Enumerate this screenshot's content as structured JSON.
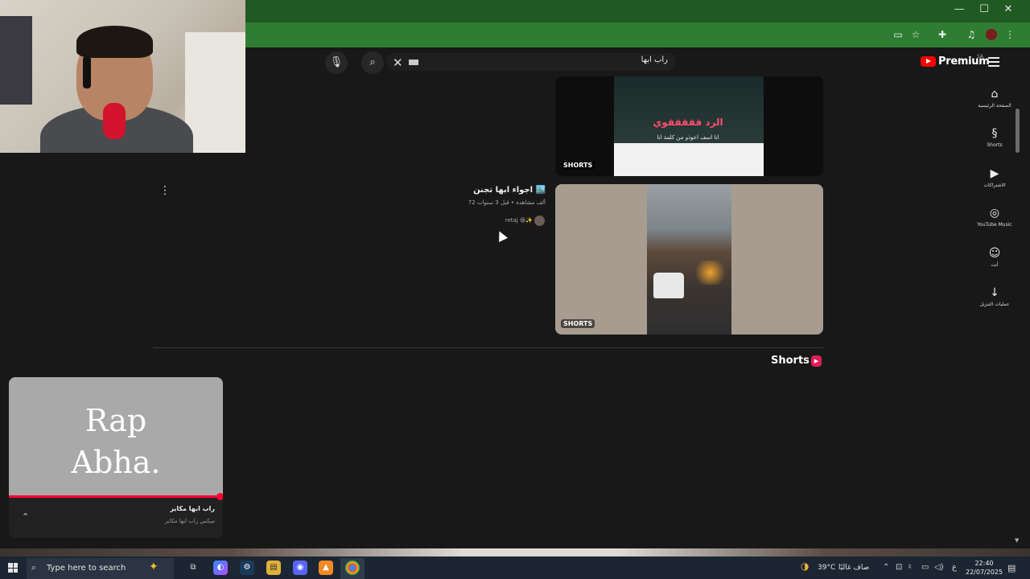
{
  "window": {
    "minimize": "—",
    "maximize": "☐",
    "close": "✕"
  },
  "toolbar_icons": [
    "cast-icon",
    "star-icon",
    "extensions-icon",
    "media-icon",
    "profile-icon",
    "menu-icon"
  ],
  "youtube": {
    "logo_text": "Premium",
    "region": "SA",
    "search_query": "راب ابها",
    "sidebar": [
      {
        "label": "الصفحة الرئيسية",
        "icon": "⌂"
      },
      {
        "label": "Shorts",
        "icon": "§"
      },
      {
        "label": "الاشتراكات",
        "icon": "▶"
      },
      {
        "label": "YouTube Music",
        "icon": "◎"
      },
      {
        "label": "أنت",
        "icon": "☺"
      },
      {
        "label": "عمليات التنزيل",
        "icon": "↓"
      }
    ],
    "card1": {
      "caption": "الرد قققققوي",
      "sub": "انا اسف اعوذو من كلمة انا",
      "badge": "SHORTS"
    },
    "card2": {
      "title": "اجواء ابها تجنن 🏙️",
      "meta": "72 ألف مشاهدة • قبل 3 سنوات",
      "channel": "retaj 😆✨",
      "badge": "SHORTS"
    },
    "shorts_heading": "Shorts"
  },
  "miniplayer": {
    "screen_line1": "Rap",
    "screen_line2": "Abha.",
    "title": "راب ابها مكاير",
    "subtitle": "ميكس راب ابها مكاير",
    "progress": 0.985
  },
  "taskbar": {
    "search_placeholder": "Type here to search",
    "temp": "39°C",
    "weather_text": "صاف غالبًا",
    "lang": "ع",
    "time": "22:40",
    "date": "22/07/2025"
  }
}
